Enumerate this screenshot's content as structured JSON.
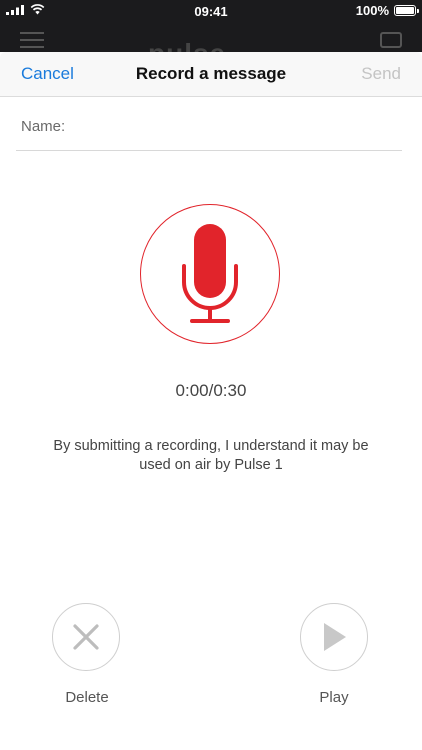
{
  "status_bar": {
    "time": "09:41",
    "battery": "100%",
    "signal_icon": "cellular-signal-icon",
    "wifi_icon": "wifi-icon",
    "battery_icon": "battery-icon"
  },
  "app_header": {
    "logo": "pulse",
    "menu_icon": "hamburger-menu-icon",
    "chat_icon": "chat-bubble-icon"
  },
  "nav": {
    "cancel": "Cancel",
    "title": "Record a message",
    "send": "Send"
  },
  "form": {
    "name_label": "Name:",
    "name_value": ""
  },
  "recorder": {
    "mic_icon": "microphone-icon",
    "timer": "0:00/0:30",
    "disclaimer": "By submitting a recording, I understand it may be used on air by Pulse 1"
  },
  "controls": {
    "delete_label": "Delete",
    "delete_icon": "close-icon",
    "play_label": "Play",
    "play_icon": "play-icon"
  },
  "colors": {
    "accent_red": "#e1242b",
    "link_blue": "#1a7bdc",
    "disabled_gray": "#c4c4c4",
    "header_dark": "#1b1b1d"
  }
}
